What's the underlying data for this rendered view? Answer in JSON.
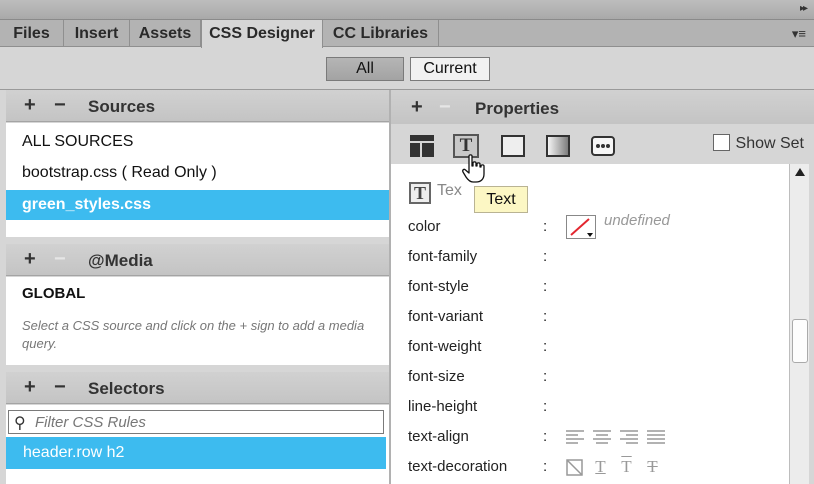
{
  "tabs": [
    {
      "label": "Files"
    },
    {
      "label": "Insert"
    },
    {
      "label": "Assets"
    },
    {
      "label": "CSS Designer",
      "active": true
    },
    {
      "label": "CC Libraries"
    }
  ],
  "icons": {
    "collapse": "double-chevron-right-icon",
    "panel_menu": "panel-menu-icon",
    "search": "search-icon",
    "cursor": "hand-pointer-icon"
  },
  "view_toggle": {
    "all_label": "All",
    "current_label": "Current",
    "selected": "All"
  },
  "sources": {
    "title": "Sources",
    "add_glyph": "+",
    "remove_glyph": "−",
    "items": [
      {
        "label": "ALL SOURCES"
      },
      {
        "label": "bootstrap.css  ( Read Only )"
      },
      {
        "label": "green_styles.css",
        "selected": true
      }
    ]
  },
  "media": {
    "title": "@Media",
    "add_glyph": "+",
    "remove_glyph": "−",
    "global_label": "GLOBAL",
    "hint": "Select a CSS source and click on the + sign to add a media query."
  },
  "selectors": {
    "title": "Selectors",
    "add_glyph": "+",
    "remove_glyph": "−",
    "filter_placeholder": "Filter CSS Rules",
    "items": [
      {
        "label": "header.row h2",
        "selected": true
      }
    ]
  },
  "properties": {
    "title": "Properties",
    "add_glyph": "+",
    "remove_glyph": "−",
    "category_icons": [
      "layout-icon",
      "text-icon",
      "border-icon",
      "background-icon",
      "more-icon"
    ],
    "active_category": "text-icon",
    "show_set_label": "Show Set",
    "show_set_checked": false,
    "section_title": "Tex",
    "tooltip": "Text",
    "rows": [
      {
        "name": "color",
        "value": "undefined"
      },
      {
        "name": "font-family"
      },
      {
        "name": "font-style"
      },
      {
        "name": "font-variant"
      },
      {
        "name": "font-weight"
      },
      {
        "name": "font-size"
      },
      {
        "name": "line-height"
      },
      {
        "name": "text-align"
      },
      {
        "name": "text-decoration"
      }
    ],
    "colon": ":",
    "text_align_options": [
      "align-left-icon",
      "align-center-icon",
      "align-right-icon",
      "align-justify-icon"
    ],
    "text_decoration_options": [
      "none-icon",
      "underline-icon",
      "overline-icon",
      "line-through-icon"
    ]
  },
  "colors": {
    "selection": "#3dbbef",
    "tooltip_bg": "#fcf7c4",
    "panel_bg": "#d6d6d6"
  }
}
